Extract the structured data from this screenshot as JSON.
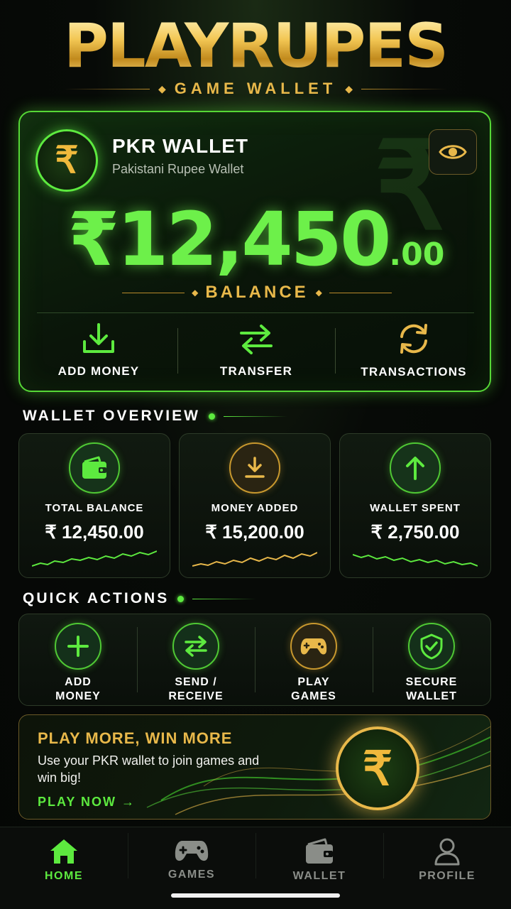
{
  "header": {
    "brand": "PLAYRUPES",
    "subtitle": "GAME WALLET"
  },
  "wallet": {
    "title": "PKR WALLET",
    "subtitle": "Pakistani Rupee Wallet",
    "currency_symbol": "₹",
    "balance_main": "₹12,450",
    "balance_decimal": ".00",
    "balance_label": "BALANCE",
    "actions": [
      {
        "label": "ADD MONEY",
        "icon": "download-icon"
      },
      {
        "label": "TRANSFER",
        "icon": "transfer-arrows-icon"
      },
      {
        "label": "TRANSACTIONS",
        "icon": "refresh-icon"
      }
    ]
  },
  "overview": {
    "title": "WALLET OVERVIEW",
    "cards": [
      {
        "label": "TOTAL BALANCE",
        "value": "₹ 12,450.00",
        "icon": "wallet-icon"
      },
      {
        "label": "MONEY ADDED",
        "value": "₹ 15,200.00",
        "icon": "download-icon"
      },
      {
        "label": "WALLET SPENT",
        "value": "₹ 2,750.00",
        "icon": "arrow-up-icon"
      }
    ]
  },
  "quick_actions": {
    "title": "QUICK ACTIONS",
    "items": [
      {
        "line1": "ADD",
        "line2": "MONEY",
        "icon": "plus-icon"
      },
      {
        "line1": "SEND /",
        "line2": "RECEIVE",
        "icon": "transfer-arrows-icon"
      },
      {
        "line1": "PLAY",
        "line2": "GAMES",
        "icon": "gamepad-icon"
      },
      {
        "line1": "SECURE",
        "line2": "WALLET",
        "icon": "shield-check-icon"
      }
    ]
  },
  "promo": {
    "title": "PLAY MORE, WIN MORE",
    "text": "Use your PKR wallet to join games and win big!",
    "cta": "PLAY NOW →",
    "coin_symbol": "₹"
  },
  "bottom_nav": {
    "items": [
      {
        "label": "HOME",
        "icon": "home-icon",
        "active": true
      },
      {
        "label": "GAMES",
        "icon": "gamepad-icon",
        "active": false
      },
      {
        "label": "WALLET",
        "icon": "wallet-icon",
        "active": false
      },
      {
        "label": "PROFILE",
        "icon": "profile-icon",
        "active": false
      }
    ]
  },
  "colors": {
    "accent_green": "#5dea3f",
    "accent_gold": "#e8b84a",
    "background": "#070a07"
  }
}
